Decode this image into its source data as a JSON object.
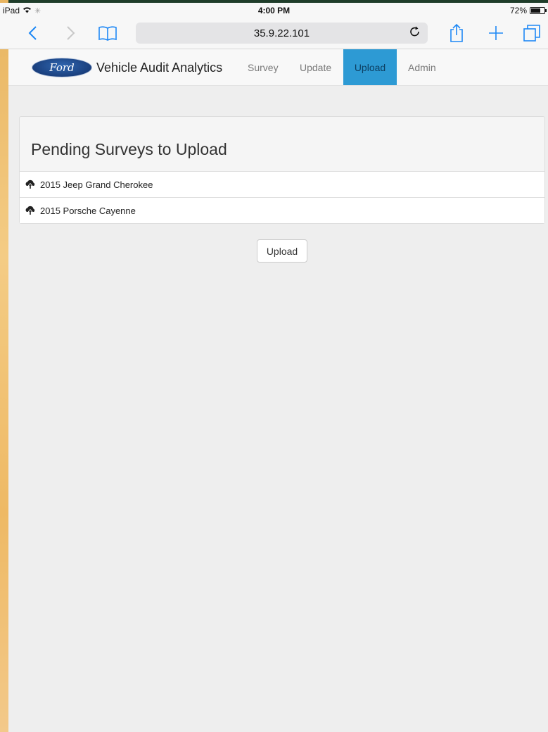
{
  "status_bar": {
    "device": "iPad",
    "time": "4:00 PM",
    "battery": "72%",
    "battery_level": 0.72
  },
  "browser": {
    "url": "35.9.22.101",
    "icons": [
      "back-icon",
      "forward-icon",
      "bookmarks-icon",
      "reload-icon",
      "share-icon",
      "new-tab-icon",
      "tabs-icon"
    ]
  },
  "navbar": {
    "logo_text": "Ford",
    "brand": "Vehicle Audit Analytics",
    "items": [
      {
        "label": "Survey",
        "active": false
      },
      {
        "label": "Update",
        "active": false
      },
      {
        "label": "Upload",
        "active": true
      },
      {
        "label": "Admin",
        "active": false
      }
    ]
  },
  "panel": {
    "title": "Pending Surveys to Upload",
    "rows": [
      {
        "label": "2015 Jeep Grand Cherokee",
        "icon": "cloud-upload-icon"
      },
      {
        "label": "2015 Porsche Cayenne",
        "icon": "cloud-upload-icon"
      }
    ]
  },
  "actions": {
    "upload_label": "Upload"
  },
  "colors": {
    "active_nav": "#2d9ad4",
    "browser_accent": "#1e88f5",
    "content_bg": "#eeeeee"
  }
}
